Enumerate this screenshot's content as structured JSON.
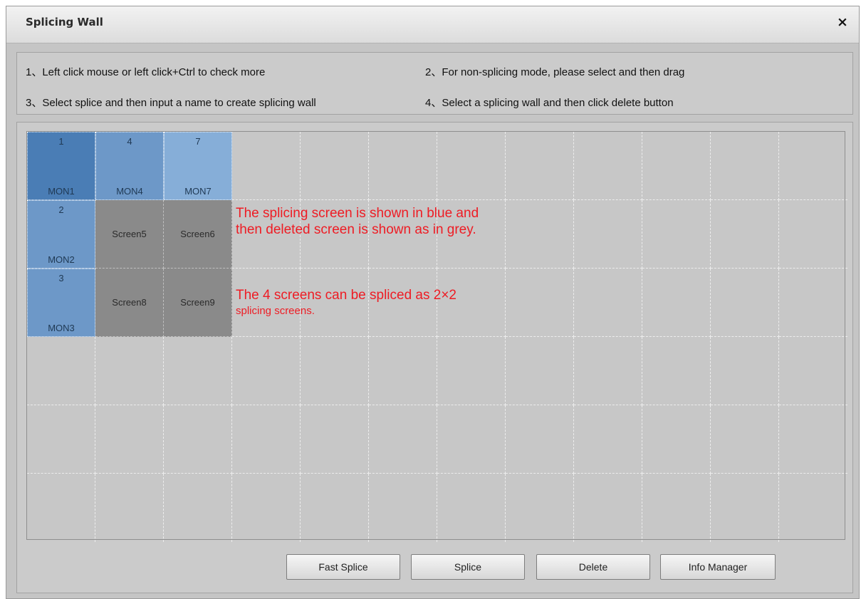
{
  "dialog": {
    "title": "Splicing Wall",
    "close_glyph": "×"
  },
  "instructions": [
    "1、Left click mouse or left click+Ctrl to check more",
    "2、For non-splicing mode, please select and then drag",
    "3、Select splice and then input a name to create splicing wall",
    "4、Select a splicing wall and then click delete button"
  ],
  "monitors": [
    {
      "number": "1",
      "label": "MON1",
      "color": "#4a7db5"
    },
    {
      "number": "4",
      "label": "MON4",
      "color": "#6d98c8"
    },
    {
      "number": "7",
      "label": "MON7",
      "color": "#86aed8"
    },
    {
      "number": "2",
      "label": "MON2",
      "color": "#6d98c8"
    },
    {
      "number": "3",
      "label": "MON3",
      "color": "#6d98c8"
    }
  ],
  "screens": [
    {
      "label": "Screen5"
    },
    {
      "label": "Screen6"
    },
    {
      "label": "Screen8"
    },
    {
      "label": "Screen9"
    }
  ],
  "annotations": {
    "note1": "The splicing screen is shown in blue and\nthen deleted screen is shown as in grey.",
    "note2": "The 4 screens can be spliced as 2×2\nsplicing screens."
  },
  "buttons": {
    "fast_splice": "Fast Splice",
    "splice": "Splice",
    "delete": "Delete",
    "info_manager": "Info Manager"
  },
  "colors": {
    "annotation": "#ee1c24",
    "deleted_screen": "#8a8a8a"
  },
  "icons": {
    "close": "close-icon"
  }
}
